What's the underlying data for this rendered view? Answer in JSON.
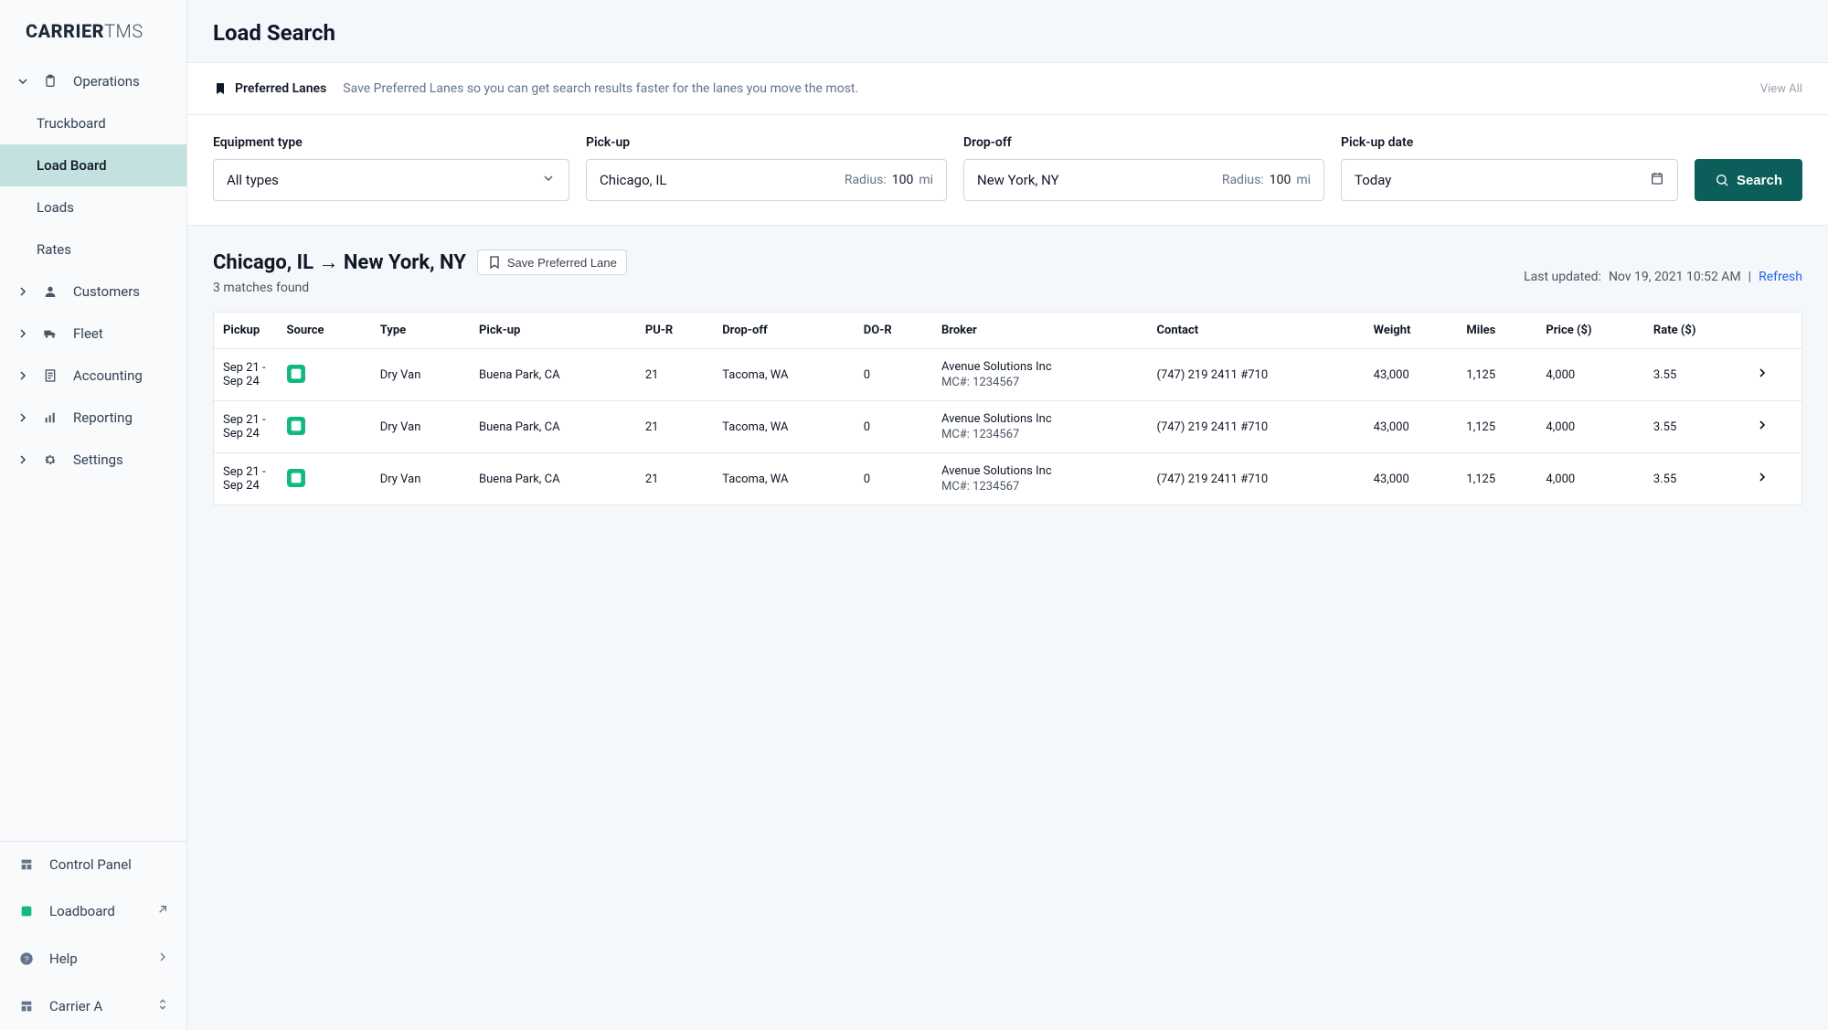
{
  "brand": {
    "part1": "CARRIER",
    "part2": "TMS"
  },
  "sidebar": {
    "groups": [
      {
        "label": "Operations",
        "expanded": true,
        "items": [
          {
            "label": "Truckboard"
          },
          {
            "label": "Load Board",
            "active": true
          },
          {
            "label": "Loads"
          },
          {
            "label": "Rates"
          }
        ]
      },
      {
        "label": "Customers"
      },
      {
        "label": "Fleet"
      },
      {
        "label": "Accounting"
      },
      {
        "label": "Reporting"
      },
      {
        "label": "Settings"
      }
    ],
    "footer": {
      "control_panel": "Control Panel",
      "loadboard": "Loadboard",
      "help": "Help",
      "carrier": "Carrier A"
    }
  },
  "page": {
    "title": "Load Search",
    "preferred_lanes": {
      "title": "Preferred Lanes",
      "desc": "Save Preferred Lanes so you can get search results faster for the lanes you move the most.",
      "view_all": "View All"
    },
    "filters": {
      "equipment_label": "Equipment type",
      "equipment_value": "All types",
      "pickup_label": "Pick-up",
      "pickup_value": "Chicago, IL",
      "pickup_radius_label": "Radius:",
      "pickup_radius_value": "100",
      "pickup_radius_unit": "mi",
      "dropoff_label": "Drop-off",
      "dropoff_value": "New York, NY",
      "dropoff_radius_label": "Radius:",
      "dropoff_radius_value": "100",
      "dropoff_radius_unit": "mi",
      "date_label": "Pick-up date",
      "date_value": "Today",
      "search_btn": "Search"
    },
    "results": {
      "lane": "Chicago, IL → New York, NY",
      "save_lane": "Save Preferred Lane",
      "matches_found": "3 matches found",
      "last_updated_label": "Last updated:",
      "last_updated_value": "Nov 19, 2021 10:52 AM",
      "refresh": "Refresh",
      "columns": {
        "pickup": "Pickup",
        "source": "Source",
        "type": "Type",
        "pickup_loc": "Pick-up",
        "pu_r": "PU-R",
        "dropoff_loc": "Drop-off",
        "do_r": "DO-R",
        "broker": "Broker",
        "contact": "Contact",
        "weight": "Weight",
        "miles": "Miles",
        "price": "Price ($)",
        "rate": "Rate ($)"
      },
      "rows": [
        {
          "pickup_range": "Sep 21 - Sep 24",
          "type": "Dry Van",
          "pickup_loc": "Buena Park, CA",
          "pu_r": "21",
          "dropoff_loc": "Tacoma, WA",
          "do_r": "0",
          "broker_name": "Avenue Solutions Inc",
          "broker_mc": "MC#: 1234567",
          "contact": "(747) 219 2411 #710",
          "weight": "43,000",
          "miles": "1,125",
          "price": "4,000",
          "rate": "3.55"
        },
        {
          "pickup_range": "Sep 21 - Sep 24",
          "type": "Dry Van",
          "pickup_loc": "Buena Park, CA",
          "pu_r": "21",
          "dropoff_loc": "Tacoma, WA",
          "do_r": "0",
          "broker_name": "Avenue Solutions Inc",
          "broker_mc": "MC#: 1234567",
          "contact": "(747) 219 2411 #710",
          "weight": "43,000",
          "miles": "1,125",
          "price": "4,000",
          "rate": "3.55"
        },
        {
          "pickup_range": "Sep 21 - Sep 24",
          "type": "Dry Van",
          "pickup_loc": "Buena Park, CA",
          "pu_r": "21",
          "dropoff_loc": "Tacoma, WA",
          "do_r": "0",
          "broker_name": "Avenue Solutions Inc",
          "broker_mc": "MC#: 1234567",
          "contact": "(747) 219 2411 #710",
          "weight": "43,000",
          "miles": "1,125",
          "price": "4,000",
          "rate": "3.55"
        }
      ]
    }
  }
}
